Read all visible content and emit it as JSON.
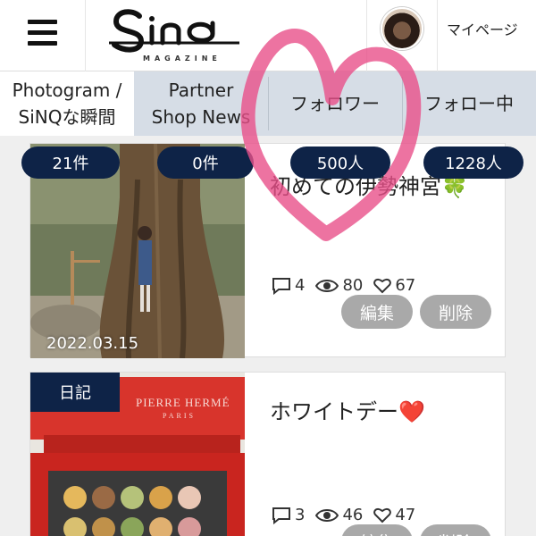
{
  "header": {
    "logo_text": "SiNQ",
    "logo_sub": "MAGAZINE",
    "mypage_label": "マイページ"
  },
  "tabs": [
    {
      "label_line1": "Photogram /",
      "label_line2": "SiNQな瞬間"
    },
    {
      "label_line1": "Partner",
      "label_line2": "Shop News"
    },
    {
      "label": "フォロワー"
    },
    {
      "label": "フォロー中"
    }
  ],
  "counts": [
    "21件",
    "0件",
    "500人",
    "1228人"
  ],
  "posts": [
    {
      "title": "初めての伊勢神宮",
      "title_emoji": "🍀",
      "date": "2022.03.15",
      "comments": "4",
      "views": "80",
      "likes": "67",
      "edit_label": "編集",
      "delete_label": "削除"
    },
    {
      "title": "ホワイトデー",
      "title_emoji": "❤️",
      "tag": "日記",
      "comments": "3",
      "views": "46",
      "likes": "47",
      "edit_label": "編集",
      "delete_label": "削除",
      "box_brand": "PIERRE HERMÉ",
      "box_city": "PARIS"
    }
  ],
  "colors": {
    "navy": "#0e2347",
    "tab_bg": "#d6dde6",
    "button_gray": "#a9a9a9",
    "heart_pink": "#e9508a"
  }
}
